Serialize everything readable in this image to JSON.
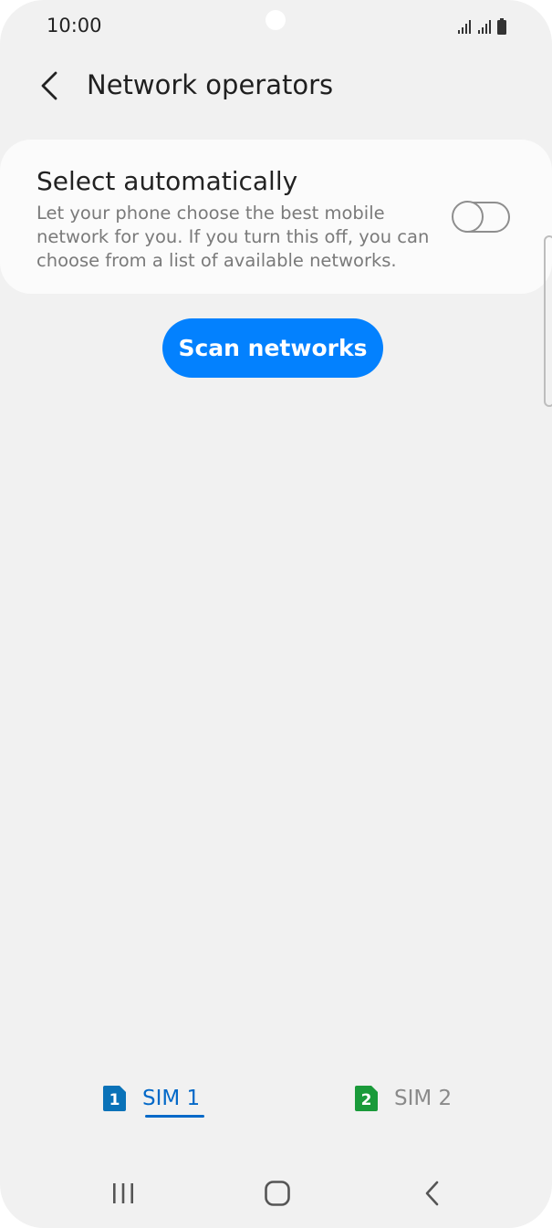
{
  "status_bar": {
    "time": "10:00",
    "icons": [
      "signal-sim1-icon",
      "signal-sim2-icon",
      "battery-icon"
    ]
  },
  "header": {
    "back_icon": "chevron-left-icon",
    "title": "Network operators"
  },
  "select_automatically": {
    "title": "Select automatically",
    "description": "Let your phone choose the best mobile network for you. If you turn this off, you can choose from a list of available networks.",
    "toggle_on": false
  },
  "scan_button": {
    "label": "Scan networks",
    "color": "#0381fe"
  },
  "sim_tabs": {
    "selected": "SIM 1",
    "items": [
      {
        "number": "1",
        "label": "SIM 1",
        "color": "#0a72b8"
      },
      {
        "number": "2",
        "label": "SIM 2",
        "color": "#1a9a3a"
      }
    ]
  },
  "nav_bar": {
    "recent_icon": "recent-apps-icon",
    "home_icon": "home-icon",
    "back_icon": "back-icon"
  }
}
